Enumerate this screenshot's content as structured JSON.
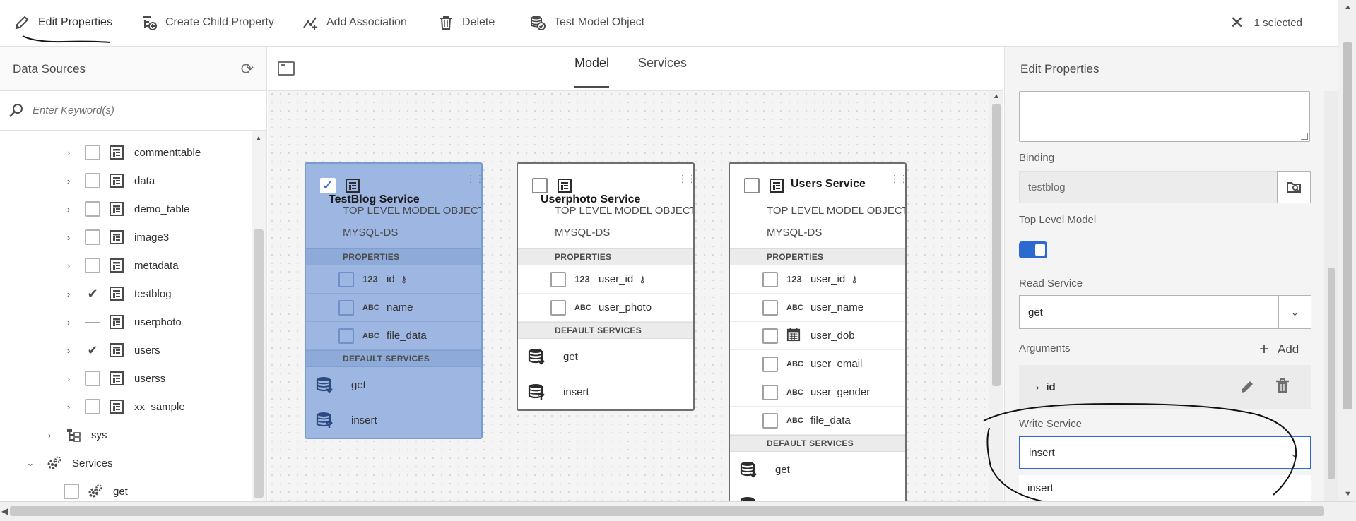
{
  "toolbar": {
    "edit_properties": "Edit Properties",
    "create_child_property": "Create Child Property",
    "add_association": "Add Association",
    "delete": "Delete",
    "test_model_object": "Test Model Object",
    "selection_count": "1 selected"
  },
  "left_panel": {
    "title": "Data Sources",
    "search_placeholder": "Enter Keyword(s)",
    "tables": [
      {
        "label": "commenttable",
        "state": "unchecked"
      },
      {
        "label": "data",
        "state": "unchecked"
      },
      {
        "label": "demo_table",
        "state": "unchecked"
      },
      {
        "label": "image3",
        "state": "unchecked"
      },
      {
        "label": "metadata",
        "state": "unchecked"
      },
      {
        "label": "testblog",
        "state": "checked"
      },
      {
        "label": "userphoto",
        "state": "partial"
      },
      {
        "label": "users",
        "state": "checked"
      },
      {
        "label": "userss",
        "state": "unchecked"
      },
      {
        "label": "xx_sample",
        "state": "unchecked"
      }
    ],
    "schema_sys": "sys",
    "services_group": "Services",
    "services": [
      {
        "label": "get"
      }
    ]
  },
  "center": {
    "tabs": [
      "Model",
      "Services"
    ],
    "active_tab": "Model",
    "cards": [
      {
        "name": "TestBlog Service",
        "selected": true,
        "top_level": "TOP LEVEL MODEL OBJECT",
        "datasource": "MYSQL-DS",
        "properties_header": "PROPERTIES",
        "properties": [
          {
            "type": "123",
            "name": "id",
            "key": true
          },
          {
            "type": "ABC",
            "name": "name",
            "key": false
          },
          {
            "type": "ABC",
            "name": "file_data",
            "key": false
          }
        ],
        "services_header": "DEFAULT SERVICES",
        "services": [
          "get",
          "insert"
        ]
      },
      {
        "name": "Userphoto Service",
        "selected": false,
        "top_level": "TOP LEVEL MODEL OBJECT",
        "datasource": "MYSQL-DS",
        "properties_header": "PROPERTIES",
        "properties": [
          {
            "type": "123",
            "name": "user_id",
            "key": true
          },
          {
            "type": "ABC",
            "name": "user_photo",
            "key": false
          }
        ],
        "services_header": "DEFAULT SERVICES",
        "services": [
          "get",
          "insert"
        ]
      },
      {
        "name": "Users Service",
        "selected": false,
        "top_level": "TOP LEVEL MODEL OBJECT",
        "datasource": "MYSQL-DS",
        "properties_header": "PROPERTIES",
        "properties": [
          {
            "type": "123",
            "name": "user_id",
            "key": true
          },
          {
            "type": "ABC",
            "name": "user_name",
            "key": false
          },
          {
            "type": "DATE",
            "name": "user_dob",
            "key": false
          },
          {
            "type": "ABC",
            "name": "user_email",
            "key": false
          },
          {
            "type": "ABC",
            "name": "user_gender",
            "key": false
          },
          {
            "type": "ABC",
            "name": "file_data",
            "key": false
          }
        ],
        "services_header": "DEFAULT SERVICES",
        "services": [
          "get",
          "insert"
        ]
      }
    ]
  },
  "right_panel": {
    "title": "Edit Properties",
    "binding_label": "Binding",
    "binding_value": "testblog",
    "top_level_label": "Top Level Model",
    "top_level_on": true,
    "read_service_label": "Read Service",
    "read_service_value": "get",
    "arguments_label": "Arguments",
    "add_label": "Add",
    "argument_name": "id",
    "write_service_label": "Write Service",
    "write_service_value": "insert",
    "dropdown_options": [
      "insert"
    ]
  },
  "colors": {
    "accent": "#2d6ad0",
    "selected_card": "#9db6e2"
  }
}
